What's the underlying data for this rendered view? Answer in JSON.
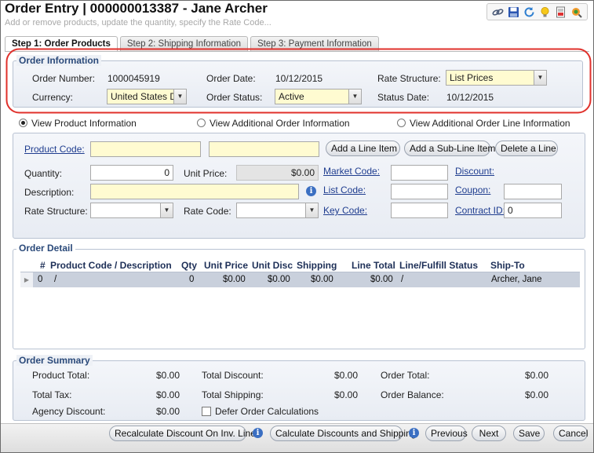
{
  "header": {
    "title": "Order Entry | 000000013387 - Jane Archer",
    "subtitle": "Add or remove products, update the quantity, specify the Rate Code..."
  },
  "toolbar": {
    "icons": [
      "link-icon",
      "save-icon",
      "refresh-icon",
      "lightbulb-icon",
      "report-icon",
      "search-icon"
    ]
  },
  "tabs": [
    {
      "label": "Step 1: Order Products"
    },
    {
      "label": "Step 2: Shipping Information"
    },
    {
      "label": "Step 3: Payment Information"
    }
  ],
  "order_info": {
    "legend": "Order Information",
    "order_number_label": "Order Number:",
    "order_number": "1000045919",
    "order_date_label": "Order Date:",
    "order_date": "10/12/2015",
    "rate_structure_label": "Rate Structure:",
    "rate_structure": "List Prices",
    "currency_label": "Currency:",
    "currency": "United States D",
    "order_status_label": "Order Status:",
    "order_status": "Active",
    "status_date_label": "Status Date:",
    "status_date": "10/12/2015",
    "highlight_color": "#e0302b"
  },
  "view_options": {
    "product": "View Product Information",
    "additional_order": "View Additional Order Information",
    "additional_line": "View Additional Order Line Information",
    "selected": "product"
  },
  "line_item": {
    "product_code_label": "Product Code:",
    "product_code": "",
    "product_name": "",
    "add_line_item": "Add a Line Item",
    "add_sub_line_item": "Add a Sub-Line Item",
    "delete_line": "Delete a Line",
    "quantity_label": "Quantity:",
    "quantity": "0",
    "unit_price_label": "Unit Price:",
    "unit_price": "$0.00",
    "market_code_label": "Market Code:",
    "market_code": "",
    "discount_label": "Discount:",
    "description_label": "Description:",
    "description": "",
    "list_code_label": "List Code:",
    "list_code": "",
    "coupon_label": "Coupon:",
    "coupon": "",
    "rate_structure_label": "Rate Structure:",
    "rate_structure": "",
    "rate_code_label": "Rate Code:",
    "rate_code": "",
    "key_code_label": "Key Code:",
    "key_code": "",
    "contract_id_label": "Contract ID:",
    "contract_id": "0"
  },
  "order_detail": {
    "legend": "Order Detail",
    "columns": [
      "#",
      "Product Code / Description",
      "Qty",
      "Unit Price",
      "Unit Disc",
      "Shipping",
      "Line Total",
      "Line/Fulfill Status",
      "Ship-To"
    ],
    "rows": [
      {
        "num": "0",
        "product": "/",
        "qty": "0",
        "unit_price": "$0.00",
        "unit_disc": "$0.00",
        "shipping": "$0.00",
        "line_total": "$0.00",
        "status": "/",
        "ship_to": "Archer, Jane"
      }
    ]
  },
  "order_summary": {
    "legend": "Order Summary",
    "product_total_label": "Product Total:",
    "product_total": "$0.00",
    "total_discount_label": "Total Discount:",
    "total_discount": "$0.00",
    "order_total_label": "Order Total:",
    "order_total": "$0.00",
    "total_tax_label": "Total Tax:",
    "total_tax": "$0.00",
    "total_shipping_label": "Total Shipping:",
    "total_shipping": "$0.00",
    "order_balance_label": "Order Balance:",
    "order_balance": "$0.00",
    "agency_discount_label": "Agency Discount:",
    "agency_discount": "$0.00",
    "defer_label": "Defer Order Calculations"
  },
  "footer": {
    "recalculate": "Recalculate Discount On Inv. Lines",
    "calculate": "Calculate Discounts and Shipping",
    "previous": "Previous",
    "next": "Next",
    "save": "Save",
    "cancel": "Cancel"
  }
}
